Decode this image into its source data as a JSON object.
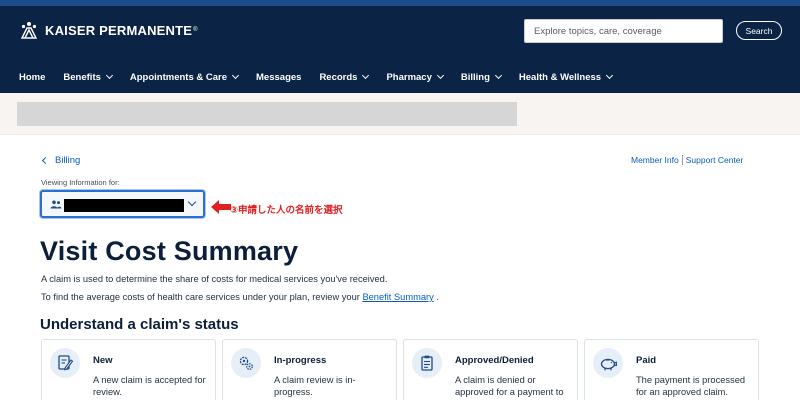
{
  "header": {
    "brand": "KAISER PERMANENTE",
    "brand_reg": "®",
    "search_placeholder": "Explore topics, care, coverage",
    "search_button": "Search"
  },
  "nav": {
    "items": [
      {
        "label": "Home",
        "dropdown": false
      },
      {
        "label": "Benefits",
        "dropdown": true
      },
      {
        "label": "Appointments & Care",
        "dropdown": true
      },
      {
        "label": "Messages",
        "dropdown": false
      },
      {
        "label": "Records",
        "dropdown": true
      },
      {
        "label": "Pharmacy",
        "dropdown": true
      },
      {
        "label": "Billing",
        "dropdown": true
      },
      {
        "label": "Health & Wellness",
        "dropdown": true
      }
    ]
  },
  "breadcrumb": {
    "back_label": "Billing"
  },
  "utility_links": {
    "member_info": "Member Info",
    "support_center": "Support Center"
  },
  "viewing": {
    "label": "Viewing Information for:"
  },
  "annotation": {
    "text": "③申請した人の名前を選択",
    "color": "#e02020"
  },
  "page": {
    "title": "Visit Cost Summary",
    "desc1": "A claim is used to determine the share of costs for medical services you've received.",
    "desc2_prefix": "To find the average costs of health care services under your plan, review your ",
    "desc2_link": "Benefit Summary",
    "desc2_suffix": " ."
  },
  "status_section": {
    "title": "Understand a claim's status",
    "cards": [
      {
        "icon": "pencil-document-icon",
        "title": "New",
        "text": "A new claim is accepted for review."
      },
      {
        "icon": "gears-icon",
        "title": "In-progress",
        "text": "A claim review is in-progress."
      },
      {
        "icon": "clipboard-checklist-icon",
        "title": "Approved/Denied",
        "text": "A claim is denied or approved for a payment to be processed."
      },
      {
        "icon": "piggy-bank-icon",
        "title": "Paid",
        "text": "The payment is processed for an approved claim."
      }
    ]
  },
  "colors": {
    "header_bg": "#0b2344",
    "link": "#0a5eb8",
    "select_border": "#2b6fd1",
    "band_bg": "#f7f4f1"
  }
}
